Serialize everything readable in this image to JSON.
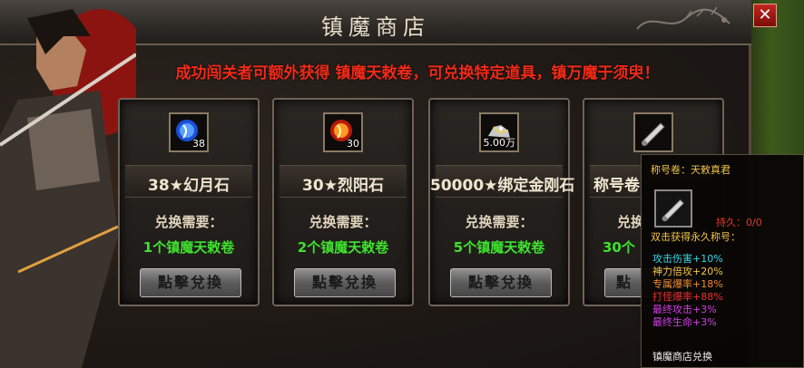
{
  "title": "镇魔商店",
  "close_label": "✕",
  "notice": "成功闯关者可额外获得 镇魔天敕卷，可兑换特定道具，镇万魔于须臾！",
  "cards": [
    {
      "item": "38★幻月石",
      "icon_count": "38",
      "icon": "blue-moonstone-icon",
      "need": "兑换需要：",
      "cost": "1个镇魔天敕卷",
      "button": "點擊兌換"
    },
    {
      "item": "30★烈阳石",
      "icon_count": "30",
      "icon": "red-sunstone-icon",
      "need": "兑换需要：",
      "cost": "2个镇魔天敕卷",
      "button": "點擊兌換"
    },
    {
      "item": "50000★绑定金刚石",
      "icon_count": "5.00万",
      "icon": "diamond-pile-icon",
      "need": "兑换需要：",
      "cost": "5个镇魔天敕卷",
      "button": "點擊兌換"
    },
    {
      "item": "称号卷",
      "icon_count": "",
      "icon": "scroll-icon",
      "need": "兑换",
      "cost": "30个",
      "button": "點"
    }
  ],
  "tooltip": {
    "title": "称号卷：天敕真君",
    "durability": "持久：0/0",
    "desc": "双击获得永久称号：",
    "stats": [
      {
        "text": "攻击伤害+10%",
        "color": "#35d8e8"
      },
      {
        "text": "神力倍攻+20%",
        "color": "#f2c44a"
      },
      {
        "text": "专属爆率+18%",
        "color": "#f08a30"
      },
      {
        "text": "打怪爆率+88%",
        "color": "#e83030"
      },
      {
        "text": "最终攻击+3%",
        "color": "#d23ee6"
      },
      {
        "text": "最终生命+3%",
        "color": "#d23ee6"
      }
    ],
    "footer": "镇魔商店兑换"
  }
}
